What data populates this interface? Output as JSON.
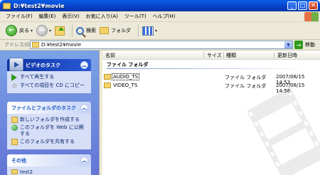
{
  "window": {
    "title": "D:¥test2¥movie"
  },
  "menu": [
    "ファイル(F)",
    "編集(E)",
    "表示(V)",
    "お気に入り(A)",
    "ツール(T)",
    "ヘルプ(H)"
  ],
  "toolbar": {
    "back_label": "戻る",
    "search_label": "検索",
    "folders_label": "フォルダ"
  },
  "address": {
    "label": "アドレス(D)",
    "value": "D:¥test2¥movie",
    "go_label": "移動"
  },
  "taskpane": {
    "video": {
      "title": "ビデオのタスク",
      "tasks": [
        "すべて再生する",
        "すべての項目を CD にコピー"
      ]
    },
    "file": {
      "title": "ファイルとフォルダのタスク",
      "tasks": [
        "新しいフォルダを作成する",
        "このフォルダを Web に公開する",
        "このフォルダを共有する"
      ]
    },
    "other": {
      "title": "その他",
      "items": [
        "test2"
      ]
    }
  },
  "columns": {
    "name": "名前",
    "size": "サイズ",
    "type": "種類",
    "date": "更新日時"
  },
  "group_title": "ファイル フォルダ",
  "files": [
    {
      "name": "AUDIO_TS",
      "type": "ファイル フォルダ",
      "date": "2007/08/15 14:53"
    },
    {
      "name": "VIDEO_TS",
      "type": "ファイル フォルダ",
      "date": "2007/08/15 14:56"
    }
  ],
  "colors": {
    "title_bar": "#0a5fe8",
    "task_pane": "#7ba2e7",
    "task_link": "#0a246a"
  }
}
